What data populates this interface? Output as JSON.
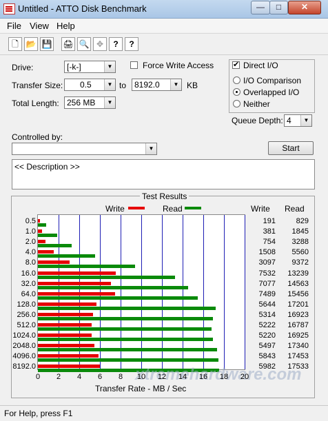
{
  "window": {
    "title": "Untitled - ATTO Disk Benchmark",
    "btn_min": "—",
    "btn_max": "□",
    "btn_close": "✕"
  },
  "menu": [
    "File",
    "View",
    "Help"
  ],
  "toolbar": [
    "new-icon",
    "open-icon",
    "save-icon",
    "print-icon",
    "print-preview-icon",
    "move-icon",
    "help-icon",
    "context-help-icon"
  ],
  "toolbar_glyphs": [
    "🗋",
    "📂",
    "💾",
    "🖨",
    "🔍",
    "✥",
    "?",
    "?"
  ],
  "form": {
    "drive_label": "Drive:",
    "drive_value": "[-k-]",
    "force_write_label": "Force Write Access",
    "transfer_size_label": "Transfer Size:",
    "transfer_from": "0.5",
    "to_label": "to",
    "transfer_to": "8192.0",
    "kb_label": "KB",
    "total_length_label": "Total Length:",
    "total_length_value": "256 MB",
    "direct_io_label": "Direct I/O",
    "direct_io_checked": "✔",
    "io_comparison_label": "I/O Comparison",
    "overlapped_io_label": "Overlapped I/O",
    "neither_label": "Neither",
    "queue_depth_label": "Queue Depth:",
    "queue_depth_value": "4",
    "controlled_by_label": "Controlled by:",
    "controlled_by_value": "",
    "start_button": "Start",
    "description": "<< Description >>"
  },
  "results": {
    "group_title": "Test Results",
    "legend_write": "Write",
    "legend_read": "Read",
    "col_write": "Write",
    "col_read": "Read",
    "write_color": "#e60000",
    "read_color": "#0a8a0a"
  },
  "chart_data": {
    "type": "bar",
    "orientation": "horizontal",
    "categories": [
      "0.5",
      "1.0",
      "2.0",
      "4.0",
      "8.0",
      "16.0",
      "32.0",
      "64.0",
      "128.0",
      "256.0",
      "512.0",
      "1024.0",
      "2048.0",
      "4096.0",
      "8192.0"
    ],
    "series": [
      {
        "name": "Write",
        "values": [
          191,
          381,
          754,
          1508,
          3097,
          7532,
          7077,
          7489,
          5644,
          5314,
          5222,
          5220,
          5497,
          5843,
          5982
        ]
      },
      {
        "name": "Read",
        "values": [
          829,
          1845,
          3288,
          5560,
          9372,
          13239,
          14563,
          15456,
          17201,
          16923,
          16787,
          16925,
          17340,
          17453,
          17533
        ]
      }
    ],
    "write_labels": [
      "191",
      "381",
      "754",
      "1508",
      "3097",
      "7532",
      "7077",
      "7489",
      "5644",
      "5314",
      "5222",
      "5220",
      "5497",
      "5843",
      "5982"
    ],
    "read_labels": [
      "829",
      "1845",
      "3288",
      "5560",
      "9372",
      "13239",
      "14563",
      "15456",
      "17201",
      "16923",
      "16787",
      "16925",
      "17340",
      "17453",
      "17533"
    ],
    "xticks": [
      "0",
      "2",
      "4",
      "6",
      "8",
      "10",
      "12",
      "14",
      "16",
      "18",
      "20"
    ],
    "xlim": [
      0,
      20
    ],
    "xlabel": "Transfer Rate - MB / Sec",
    "grid": true,
    "legend": "top"
  },
  "status": "For Help, press F1",
  "watermark": "xtremehardware.com"
}
